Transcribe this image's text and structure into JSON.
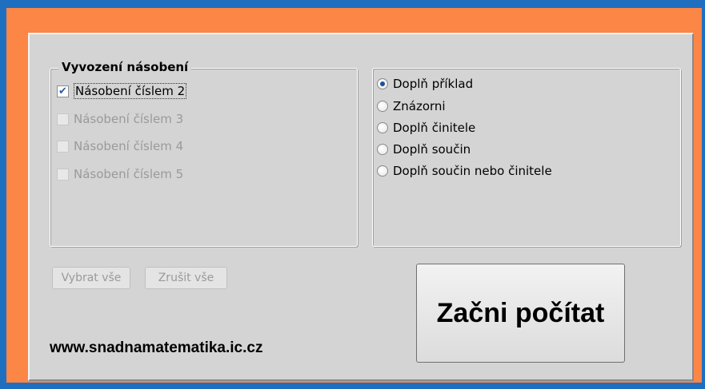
{
  "group_multiplication": {
    "title": "Vyvození násobení",
    "items": [
      {
        "label": "Násobení číslem 2",
        "checked": true,
        "enabled": true
      },
      {
        "label": "Násobení číslem 3",
        "checked": false,
        "enabled": false
      },
      {
        "label": "Násobení číslem 4",
        "checked": false,
        "enabled": false
      },
      {
        "label": "Násobení číslem 5",
        "checked": false,
        "enabled": false
      }
    ]
  },
  "group_mode": {
    "options": [
      {
        "label": "Doplň příklad",
        "selected": true
      },
      {
        "label": "Znázorni",
        "selected": false
      },
      {
        "label": "Doplň činitele",
        "selected": false
      },
      {
        "label": "Doplň součin",
        "selected": false
      },
      {
        "label": "Doplň součin nebo činitele",
        "selected": false
      }
    ]
  },
  "buttons": {
    "select_all": "Vybrat vše",
    "clear_all": "Zrušit vše",
    "start": "Začni počítat"
  },
  "footer": {
    "website": "www.snadnamatematika.ic.cz"
  },
  "colors": {
    "outer_border": "#1f6fc0",
    "frame": "#fb8646",
    "panel": "#d4d4d4",
    "radio_dot": "#1e4f9c"
  }
}
